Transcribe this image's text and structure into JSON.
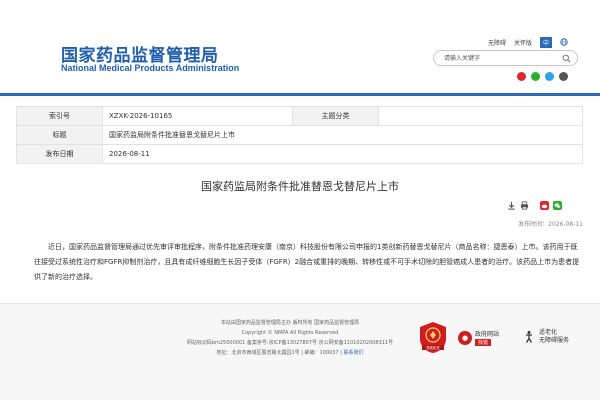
{
  "header": {
    "logo_cn": "国家药品监督管理局",
    "logo_en": "National Medical Products Administration",
    "top_links": [
      "无障碍",
      "关怀版"
    ],
    "lang_zh": "中",
    "lang_en_icon": "EN",
    "search": {
      "placeholder": "请输入关键字",
      "value": ""
    },
    "social_icons": [
      "weibo-icon",
      "wechat-icon",
      "miniprogram-icon",
      "app-icon"
    ]
  },
  "info": {
    "rows": [
      {
        "label": "索引号",
        "value": "XZXK-2026-10165",
        "label2": "主题分类",
        "value2": ""
      },
      {
        "label": "标题",
        "value": "国家药监局附条件批准替恩戈替尼片上市"
      },
      {
        "label": "发布日期",
        "value": "2026-08-11"
      }
    ]
  },
  "article": {
    "title": "国家药监局附条件批准替恩戈替尼片上市",
    "publish_label": "发布时间：2026-08-11",
    "body": "近日，国家药品监督管理局通过优先审评审批程序，附条件批准药理安康（南京）科技股份有限公司申报的1类创新药替恩戈替尼片（商品名称：捷恩泰）上市。该药用于既往接受过系统性治疗和FGFR抑制剂治疗，且具有成纤维细胞生长因子受体（FGFR）2融合或重排的晚期、转移性或不可手术切除的胆管癌成人患者的治疗。该药品上市为患者提供了新的治疗选择。",
    "tools": [
      "download-icon",
      "print-icon",
      "weibo-share-icon",
      "wechat-share-icon"
    ]
  },
  "footer": {
    "lines": [
      "本站由国家药品监督管理局主办 版权所有 国家药品监督管理局",
      "Copyright © NMPA All Rights Reserved",
      "网站标识码bm25000001   备案序号:京ICP备13027807号   京公网安备11010202008311号",
      "地址：北京市西城区展览路北露园1号 | 邮编：100037 |"
    ],
    "contact_link": "联系我们",
    "badge_gov_title": "政府网站",
    "badge_gov_error": "找错",
    "badge_access_line1": "适老化",
    "badge_access_line2": "无障碍服务",
    "badge_red_label": "党政机关"
  },
  "colors": {
    "brand_blue": "#1f5fae",
    "accent_blue": "#2a6ab8",
    "red": "#d11d1d"
  }
}
